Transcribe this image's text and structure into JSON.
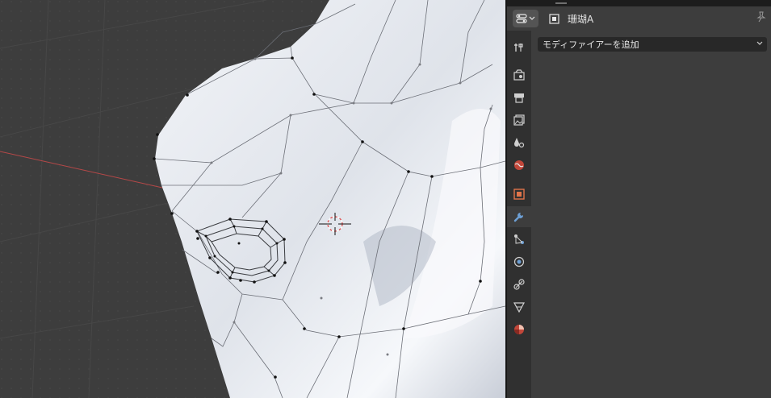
{
  "header": {
    "object_name": "珊瑚A",
    "editor_type_icon": "properties-editor-icon",
    "object_type_icon": "mesh-object-icon",
    "pin_icon": "pin-icon"
  },
  "tabs": [
    {
      "name": "tool",
      "icon": "tool-icon"
    },
    {
      "name": "render",
      "icon": "render-icon"
    },
    {
      "name": "output",
      "icon": "output-icon"
    },
    {
      "name": "view-layer",
      "icon": "view-layer-icon"
    },
    {
      "name": "scene",
      "icon": "scene-icon"
    },
    {
      "name": "world",
      "icon": "world-icon"
    },
    {
      "name": "object",
      "icon": "object-icon"
    },
    {
      "name": "modifiers",
      "icon": "wrench-icon",
      "active": true
    },
    {
      "name": "particles",
      "icon": "particles-icon"
    },
    {
      "name": "physics",
      "icon": "physics-icon"
    },
    {
      "name": "constraints",
      "icon": "constraints-icon"
    },
    {
      "name": "data",
      "icon": "mesh-data-icon"
    },
    {
      "name": "material",
      "icon": "material-icon"
    }
  ],
  "modifiers": {
    "add_label": "モディファイアーを追加"
  },
  "colors": {
    "viewport_bg": "#3d3d3d",
    "panel_bg": "#3d3d3d",
    "tabbar_bg": "#303030",
    "mesh": "#e3e7ef",
    "x_axis": "#b54848",
    "active_tab": "#6d9fd4"
  }
}
